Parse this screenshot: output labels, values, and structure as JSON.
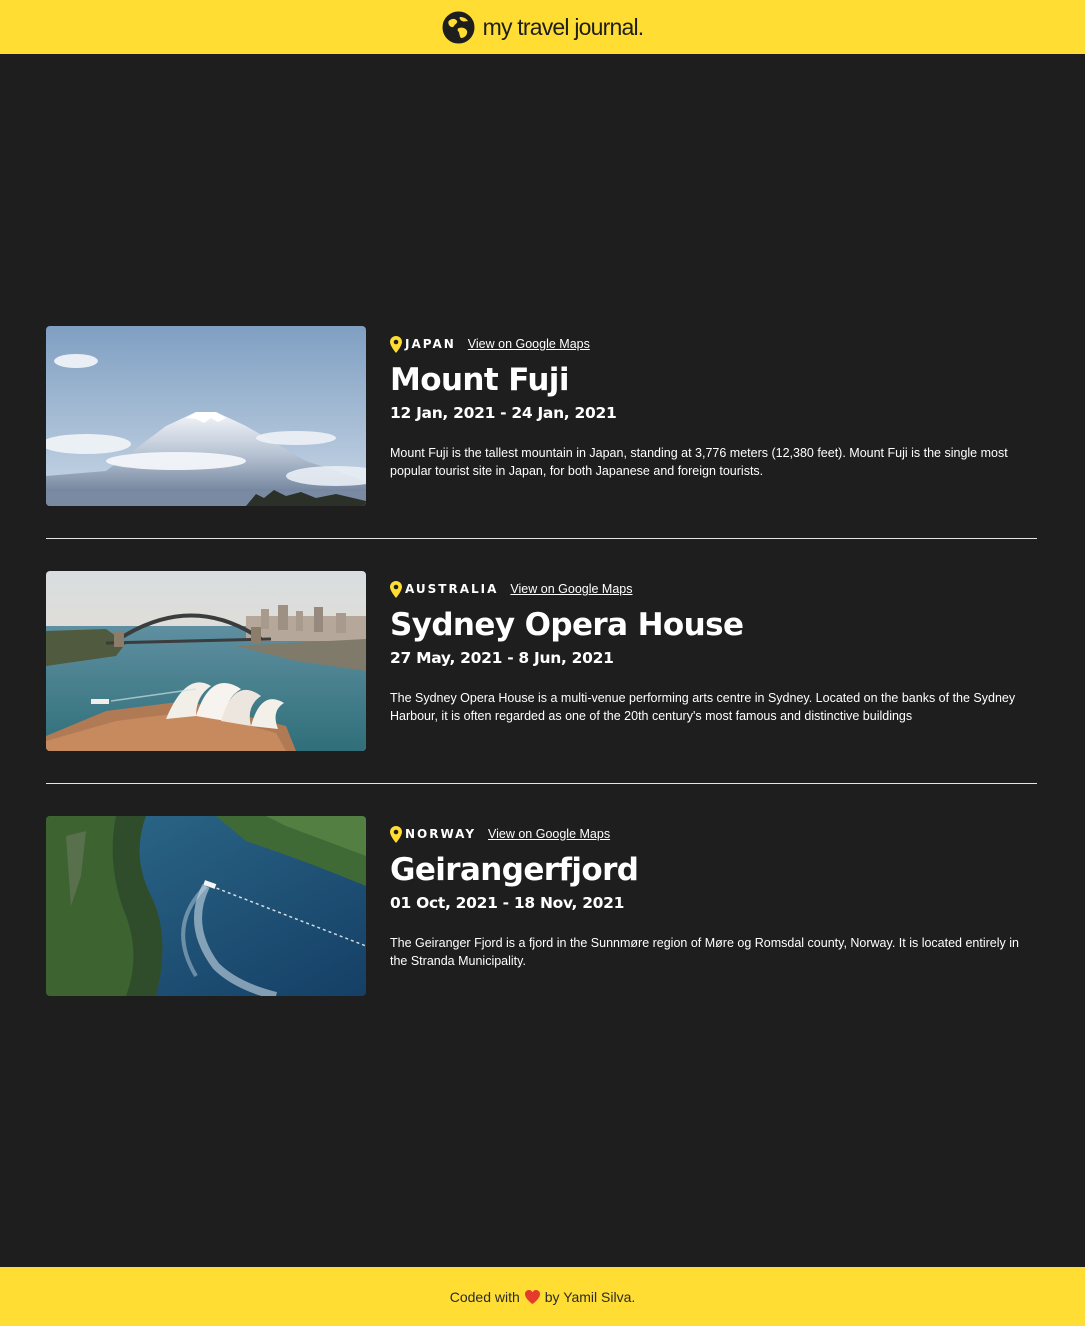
{
  "header": {
    "brand_text": "my travel journal.",
    "brand_icon": "globe-icon",
    "background": "#ffdd33"
  },
  "entries": [
    {
      "country": "JAPAN",
      "maps_label": "View on Google Maps",
      "title": "Mount Fuji",
      "dates": "12 Jan, 2021 - 24 Jan, 2021",
      "description": "Mount Fuji is the tallest mountain in Japan, standing at 3,776 meters (12,380 feet). Mount Fuji is the single most popular tourist site in Japan, for both Japanese and foreign tourists.",
      "image": "mount-fuji-photo"
    },
    {
      "country": "AUSTRALIA",
      "maps_label": "View on Google Maps",
      "title": "Sydney Opera House",
      "dates": "27 May, 2021 - 8 Jun, 2021",
      "description": "The Sydney Opera House is a multi-venue performing arts centre in Sydney. Located on the banks of the Sydney Harbour, it is often regarded as one of the 20th century's most famous and distinctive buildings",
      "image": "sydney-opera-house-photo"
    },
    {
      "country": "NORWAY",
      "maps_label": "View on Google Maps",
      "title": "Geirangerfjord",
      "dates": "01 Oct, 2021 - 18 Nov, 2021",
      "description": "The Geiranger Fjord is a fjord in the Sunnmøre region of Møre og Romsdal county, Norway. It is located entirely in the Stranda Municipality.",
      "image": "geirangerfjord-photo"
    }
  ],
  "footer": {
    "prefix": "Coded with",
    "suffix": "by Yamil Silva.",
    "heart_icon": "heart-icon"
  },
  "colors": {
    "accent": "#ffdd33",
    "background": "#1e1e1e",
    "text": "#ffffff"
  }
}
